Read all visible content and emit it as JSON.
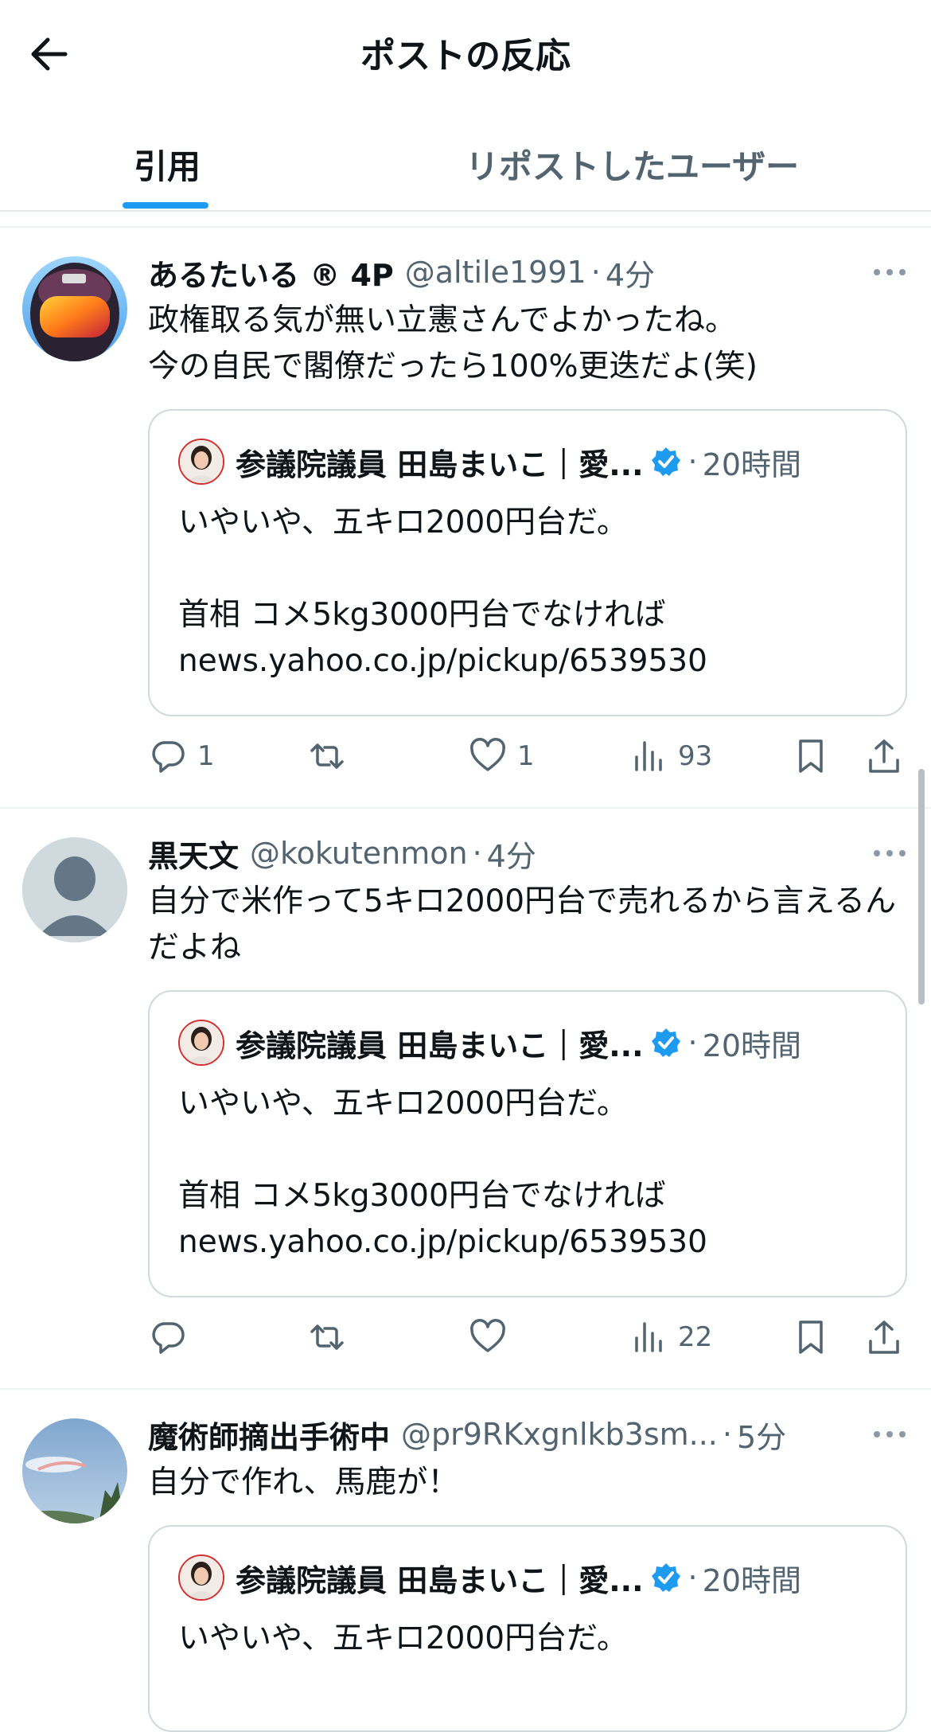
{
  "header": {
    "title": "ポストの反応"
  },
  "tabs": {
    "quotes": "引用",
    "reposts": "リポストしたユーザー"
  },
  "quoted_post": {
    "author": "参議院議員 田島まいこ｜愛...",
    "dot": "·",
    "time": "20時間",
    "text_full": "いやいや、五キロ2000円台だ。\n\n首相 コメ5kg3000円台でなければ\nnews.yahoo.co.jp/pickup/6539530",
    "text_short": "いやいや、五キロ2000円台だ。"
  },
  "posts": [
    {
      "name": "あるたいる ® 4P",
      "handle": "@altile1991",
      "dot": "·",
      "time": "4分",
      "text": "政権取る気が無い立憲さんでよかったね。\n今の自民で閣僚だったら100%更迭だよ(笑)",
      "replies": "1",
      "reposts": "",
      "likes": "1",
      "views": "93"
    },
    {
      "name": "黒天文",
      "handle": "@kokutenmon",
      "dot": "·",
      "time": "4分",
      "text": "自分で米作って5キロ2000円台で売れるから言えるんだよね",
      "replies": "",
      "reposts": "",
      "likes": "",
      "views": "22"
    },
    {
      "name": "魔術師摘出手術中",
      "handle": "@pr9RKxgnlkb3sm...",
      "dot": "·",
      "time": "5分",
      "text": "自分で作れ、馬鹿が！"
    }
  ],
  "icons": {
    "back": "arrow-left-icon",
    "more": "more-horizontal-icon",
    "reply": "reply-icon",
    "repost": "repost-icon",
    "like": "heart-icon",
    "views": "views-icon",
    "bookmark": "bookmark-icon",
    "share": "share-icon",
    "verified": "verified-badge-icon"
  },
  "colors": {
    "accent": "#1d9bf0",
    "muted": "#536471",
    "border": "#cfd9de"
  }
}
